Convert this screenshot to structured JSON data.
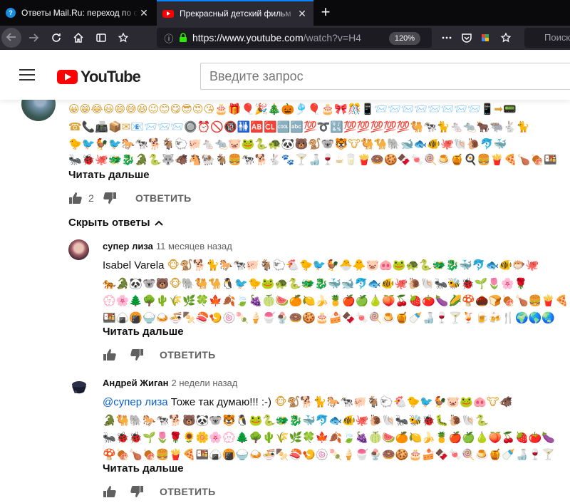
{
  "browser": {
    "tabs": [
      {
        "title": "Ответы Mail.Ru: переход по ссылке",
        "active": false
      },
      {
        "title": "Прекрасный детский фильм",
        "active": true
      }
    ],
    "close_glyph": "✕",
    "new_tab_glyph": "+",
    "url_main": "https://www.youtube.com",
    "url_rest": "/watch?v=H4",
    "zoom": "120%",
    "search_placeholder": "Поиск"
  },
  "youtube": {
    "logo_text": "YouTube",
    "search_placeholder": "Введите запрос"
  },
  "top_comment": {
    "emoji_lines": [
      "😀😁😂😃😄😅😆😉😊😋😎😍😘🎂🎁🎈🎉🎄🎃🎐🎈🎂🎀🎊📱📨📨📨📨📨📨📨📨📱➡📟",
      "☎📞📠📦✉📧📨📨📨🔘⏰🚫🔞🚻🆎🆑🆒🔤💯➰🔣💯💯💯💯💯🐫🐄🐈🐁🐀🐂🐃🐇🐈",
      "🐤🐦🐓🐦🐎🐄🐕🐐🐑🐖🐁🐀🐷🐸🐍🐢🐼🐻🐒🐨🐯🐮🐫🐪🐘🐋🐟🐠🐙🐚🐌🐬🐳",
      "🐜🐞🐙🐲🐉🐊🐍🐺🐗🐴🐏🐐🍔🐄🐕🐇🐾🍸🍶🍷☕🥛🍟🍩🍪🍫🍬🍭🍮🍯🍳🍔🍟🍕🍗🍖🍱"
    ],
    "read_more": "Читать дальше",
    "likes": "2",
    "reply_label": "ОТВЕТИТЬ"
  },
  "hide_replies_label": "Скрыть ответы",
  "replies": [
    {
      "author": "супер лиза",
      "time": "11 месяцев назад",
      "text_prefix": "Isabel Varela",
      "emoji_after_prefix": "🐵🐒🐕🐈🐎🐄🐖🐐🐑🐔🐤🐦🐓🐣🐥🐷🐽🐸🐢🐍🐲🐉🐳🐬🐟🐠🐡🐙",
      "emoji_lines": [
        "🐅🐊🐼🐨🐻🐵🐘🐫🐪🐧🐦🐤🐸🐢🐍🐲🐉🐳🐋🐬🐟🐠🐙🐌🐚🐜🐝🐞🌱🌷🌸🌹",
        "💮🌸🌲🌳🌵🌾🌿🍀🍁🍂🍃🍇🍈🍉🍊🍋🍌🍍🍎🍏🍐🍑🍒🍓🍅🍆🌽🍄🌰🍞🍖🍗🍔🍟🍕🍝",
        "🍱🍙🍘🍚🍛🍜🍢🍣🍤🍥🍡🍦🍧🍨🍩🍪🎂🍰🍫🍬🍭🍮🍯🍼🍶🍷🍸🍹🍺🍻🍴🌍🌎🌏"
      ],
      "read_more": "Читать дальше",
      "reply_label": "ОТВЕТИТЬ"
    },
    {
      "author": "Андрей Жиган",
      "time": "2 недели назад",
      "mention": "@супер лиза",
      "text": "Тоже так думаю!!! :-)",
      "emoji_after_text": "🐵🐒🐕🐈🐎🐄🐖🐐🐑🐔🐤🐦🐓🐷🐸🐽🐮🐗",
      "emoji_lines": [
        "🐊🐫🐘🐎🐄🐕🐻🐼🐨🐯🐧🐸🐍🐲🐉🐳🐬🐟🐠🐙🐌🐚🐜🐝🐞🐛🐌🐚🐍",
        "🐜🐞🐞🌱🌷🌹🌻🌼🌸💮🌲🌳🌵🌾🌿🍀🍁🍂🍃🍇🍈🍉🍊🍋🍌🍍🍎🍏🍐🍑🍒🍓🍅🍆",
        "🍄🍖🍗🍖🍔🍟🍕🍱🍙🍘🍚🍛🍜🍢🍣🍤🍥🍡🍦🍧🍨🍩🍪🎂🍰🍫🍬🍭🍮🍯🍼🍶🍷🍸"
      ],
      "read_more": "Читать дальше",
      "reply_label": "ОТВЕТИТЬ"
    }
  ]
}
